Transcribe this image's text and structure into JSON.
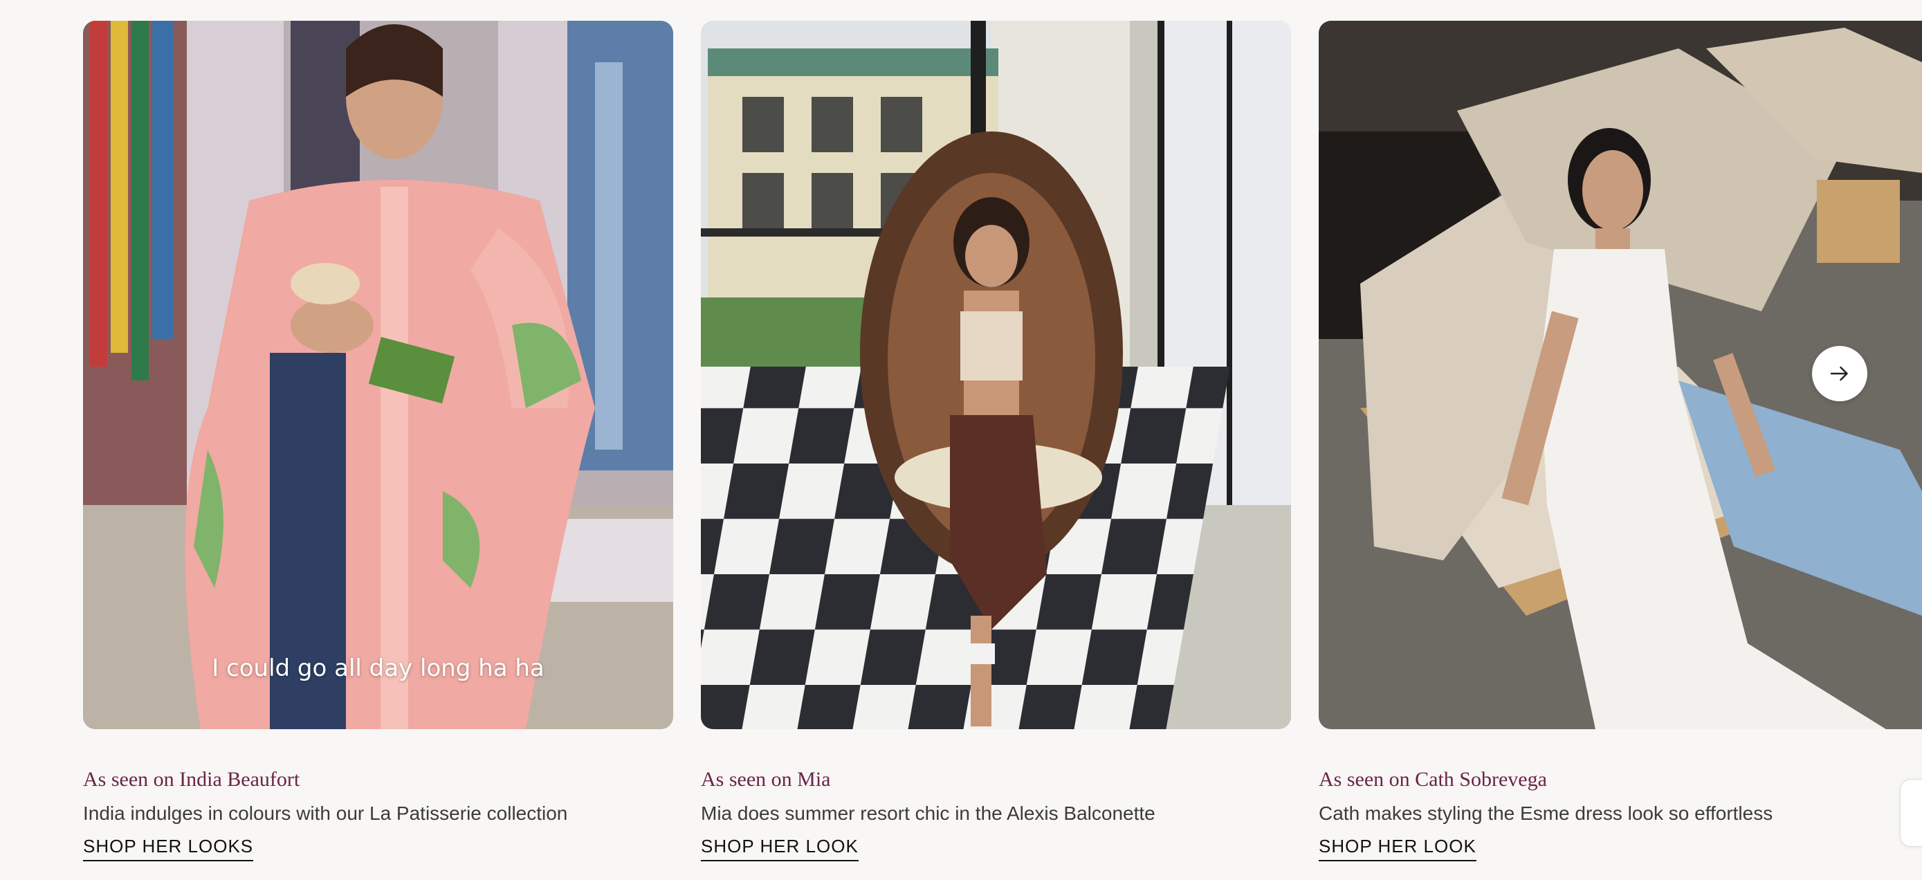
{
  "carousel": {
    "cards": [
      {
        "image_alt": "Woman in pink floral shirt dress in a boutique",
        "caption": "I could go all day long ha ha",
        "title": "As seen on India Beaufort",
        "description": "India indulges in colours with our La Patisserie collection",
        "cta": "SHOP HER LOOKS"
      },
      {
        "image_alt": "Woman sitting in a hanging rattan chair on a checkered balcony",
        "caption": "",
        "title": "As seen on Mia",
        "description": "Mia does summer resort chic in the Alexis Balconette",
        "cta": "SHOP HER LOOK"
      },
      {
        "image_alt": "Woman in white lace dress sitting on a cream sofa",
        "caption": "",
        "title": "As seen on Cath Sobrevega",
        "description": "Cath makes styling the Esme dress look so effortless",
        "cta": "SHOP HER LOOK"
      }
    ],
    "next_icon": "arrow-right-icon"
  },
  "colors": {
    "page_background": "#f8f7f5",
    "title_color": "#6b2347",
    "text_color": "#3b3b3b",
    "cta_color": "#111111"
  }
}
